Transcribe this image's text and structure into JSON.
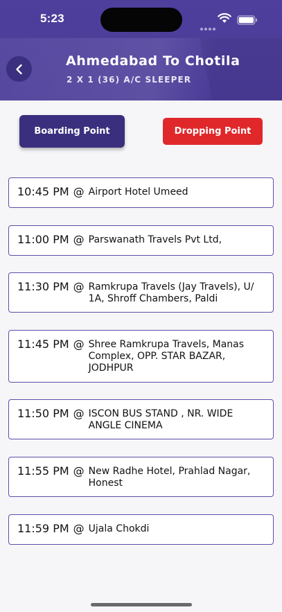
{
  "status_bar": {
    "time": "5:23"
  },
  "header": {
    "title": "Ahmedabad To Chotila",
    "subtitle": "2 X 1 (36) A/C SLEEPER",
    "back_icon": "chevron-left-icon"
  },
  "tabs": {
    "boarding_label": "Boarding Point",
    "dropping_label": "Dropping Point",
    "active": "boarding",
    "boarding_color": "#3a2f7e",
    "dropping_color": "#e0282b"
  },
  "points": [
    {
      "time": "10:45 PM",
      "at": "@",
      "place": "Airport Hotel Umeed"
    },
    {
      "time": "11:00 PM",
      "at": "@",
      "place": "Parswanath Travels Pvt Ltd,"
    },
    {
      "time": "11:30 PM",
      "at": "@",
      "place": "Ramkrupa Travels (Jay Travels), U/ 1A, Shroff Chambers, Paldi"
    },
    {
      "time": "11:45 PM",
      "at": "@",
      "place": "Shree Ramkrupa Travels, Manas Complex, OPP. STAR BAZAR, JODHPUR"
    },
    {
      "time": "11:50 PM",
      "at": "@",
      "place": "ISCON BUS STAND , NR. WIDE ANGLE CINEMA"
    },
    {
      "time": "11:55 PM",
      "at": "@",
      "place": "New Radhe Hotel, Prahlad Nagar, Honest"
    },
    {
      "time": "11:59 PM",
      "at": "@",
      "place": "Ujala Chokdi"
    }
  ]
}
